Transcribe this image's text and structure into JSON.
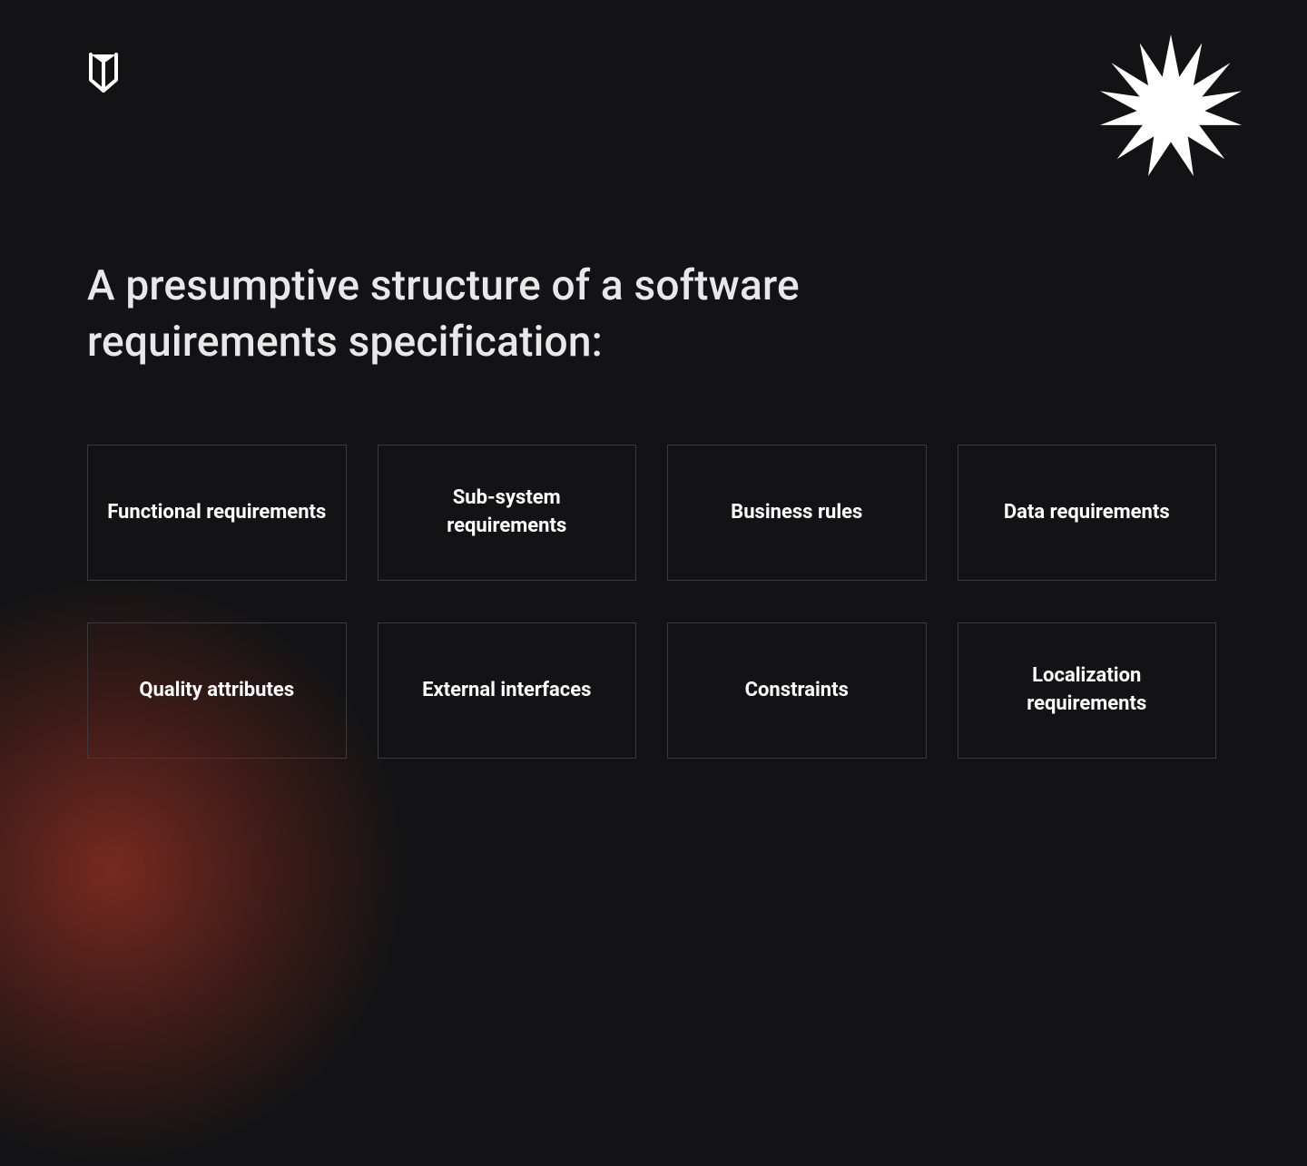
{
  "title": "A presumptive structure of a software requirements specification:",
  "cards": [
    {
      "label": "Functional requirements"
    },
    {
      "label": "Sub-system requirements"
    },
    {
      "label": "Business rules"
    },
    {
      "label": "Data requirements"
    },
    {
      "label": "Quality attributes"
    },
    {
      "label": "External interfaces"
    },
    {
      "label": "Constraints"
    },
    {
      "label": "Localization requirements"
    }
  ]
}
